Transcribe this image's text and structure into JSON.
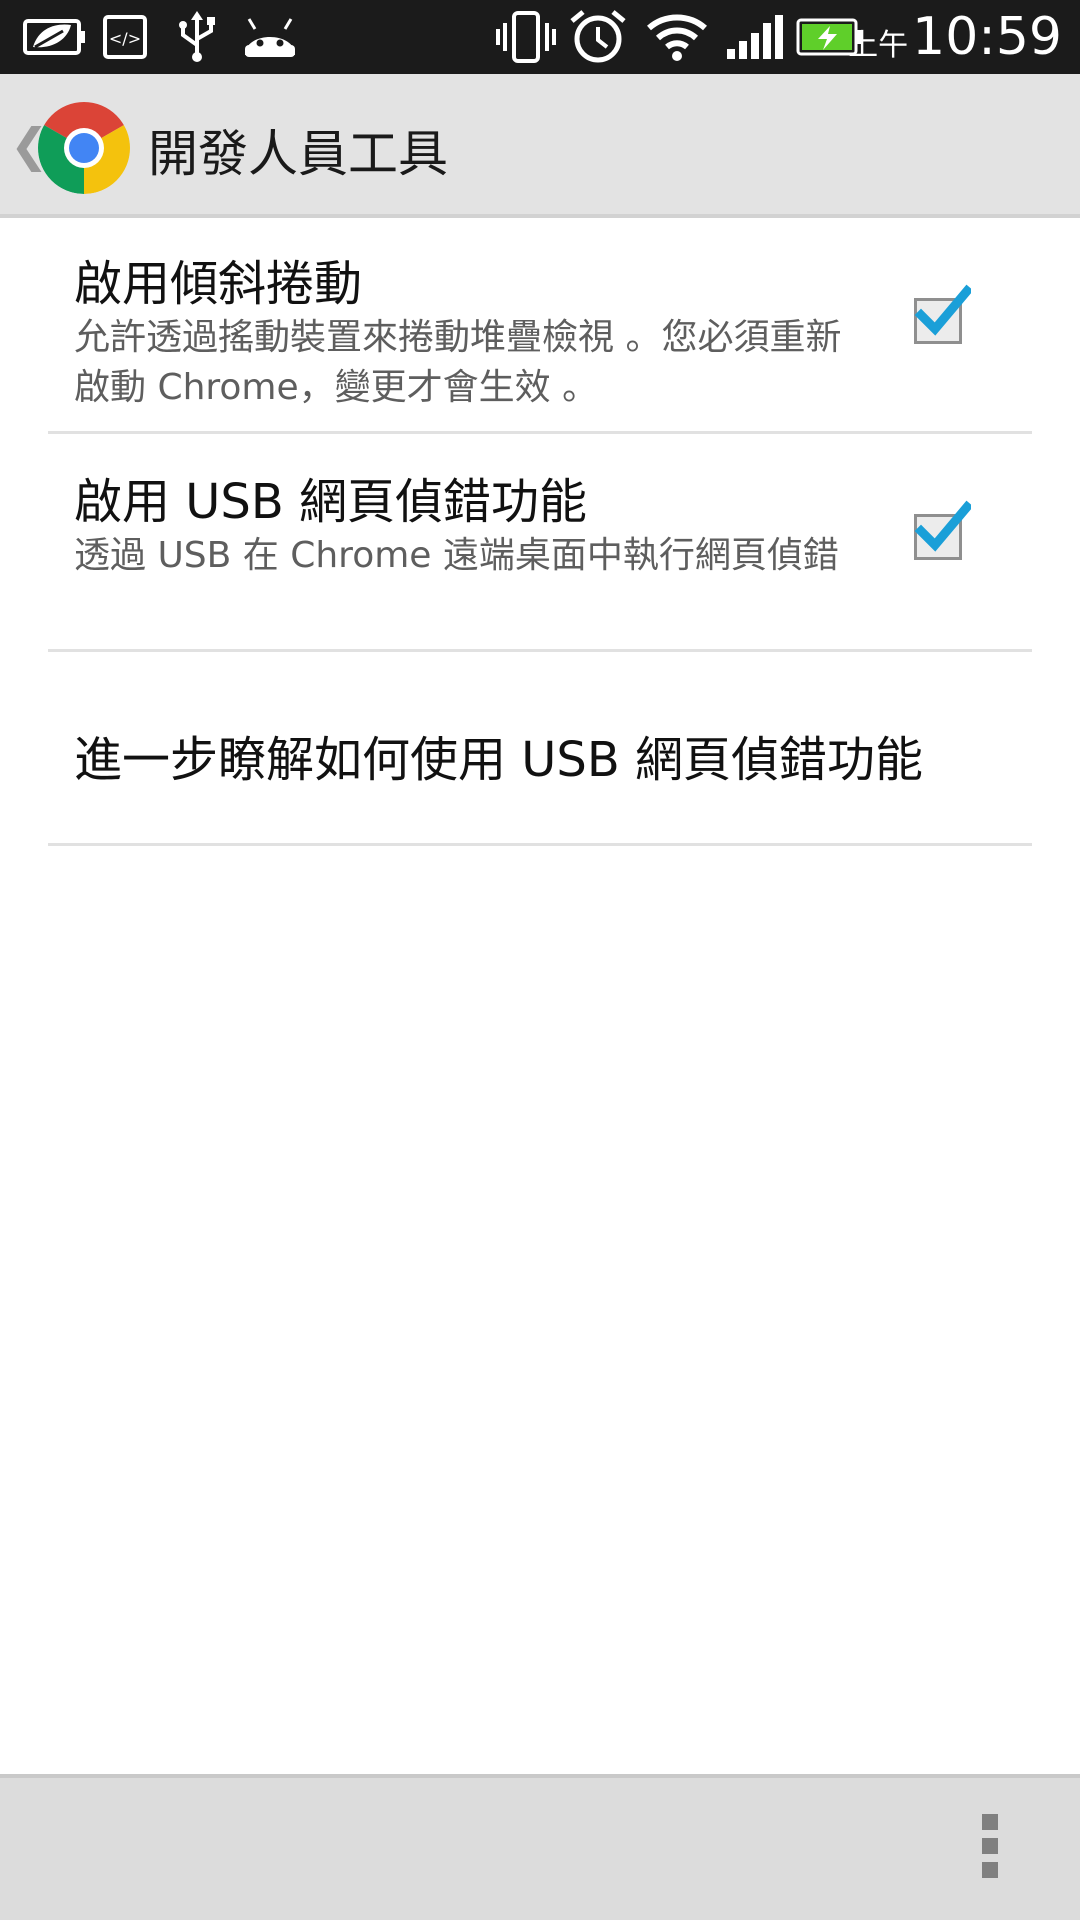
{
  "status_bar": {
    "icons": [
      "leaf-battery-saver-icon",
      "developer-code-icon",
      "usb-icon",
      "android-icon",
      "vibrate-icon",
      "alarm-clock-icon",
      "wifi-icon",
      "signal-icon",
      "battery-charging-icon"
    ],
    "ampm": "上午",
    "time": "10:59"
  },
  "action_bar": {
    "title": "開發人員工具",
    "up_glyph": "❮"
  },
  "preferences": [
    {
      "title": "啟用傾斜捲動",
      "summary": "允許透過搖動裝置來捲動堆疊檢視 。您必須重新啟動 Chrome，變更才會生效 。",
      "checked": true
    },
    {
      "title": "啟用 USB 網頁偵錯功能",
      "summary": "透過 USB 在 Chrome 遠端桌面中執行網頁偵錯",
      "checked": true
    },
    {
      "title": "進一步瞭解如何使用 USB 網頁偵錯功能"
    }
  ],
  "bottom_bar": {
    "menu_icon": "overflow-menu-icon"
  },
  "colors": {
    "checkmark": "#1a9fd8",
    "battery": "#5fcf2a",
    "actionbar_bg": "#e3e3e3",
    "statusbar_bg": "#1b1b1b"
  }
}
